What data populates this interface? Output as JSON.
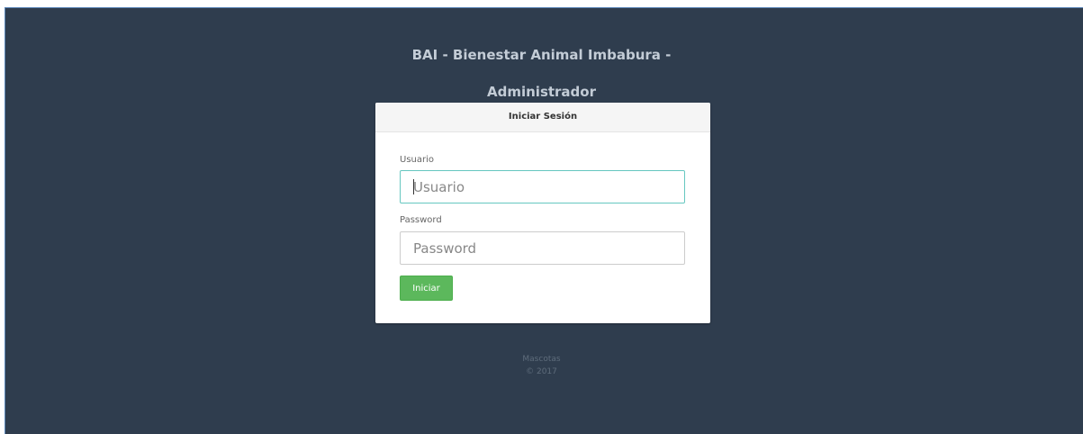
{
  "header": {
    "title_line1": "BAI - Bienestar Animal Imbabura -",
    "title_line2": "Administrador"
  },
  "login_panel": {
    "heading": "Iniciar Sesión",
    "username": {
      "label": "Usuario",
      "placeholder": "Usuario",
      "value": ""
    },
    "password": {
      "label": "Password",
      "placeholder": "Password",
      "value": ""
    },
    "submit_label": "Iniciar"
  },
  "footer": {
    "app_name": "Mascotas",
    "copyright": "© 2017"
  },
  "colors": {
    "background": "#2f3d4e",
    "submit_button": "#5cb85c",
    "focused_input_border": "#66c7c0"
  }
}
